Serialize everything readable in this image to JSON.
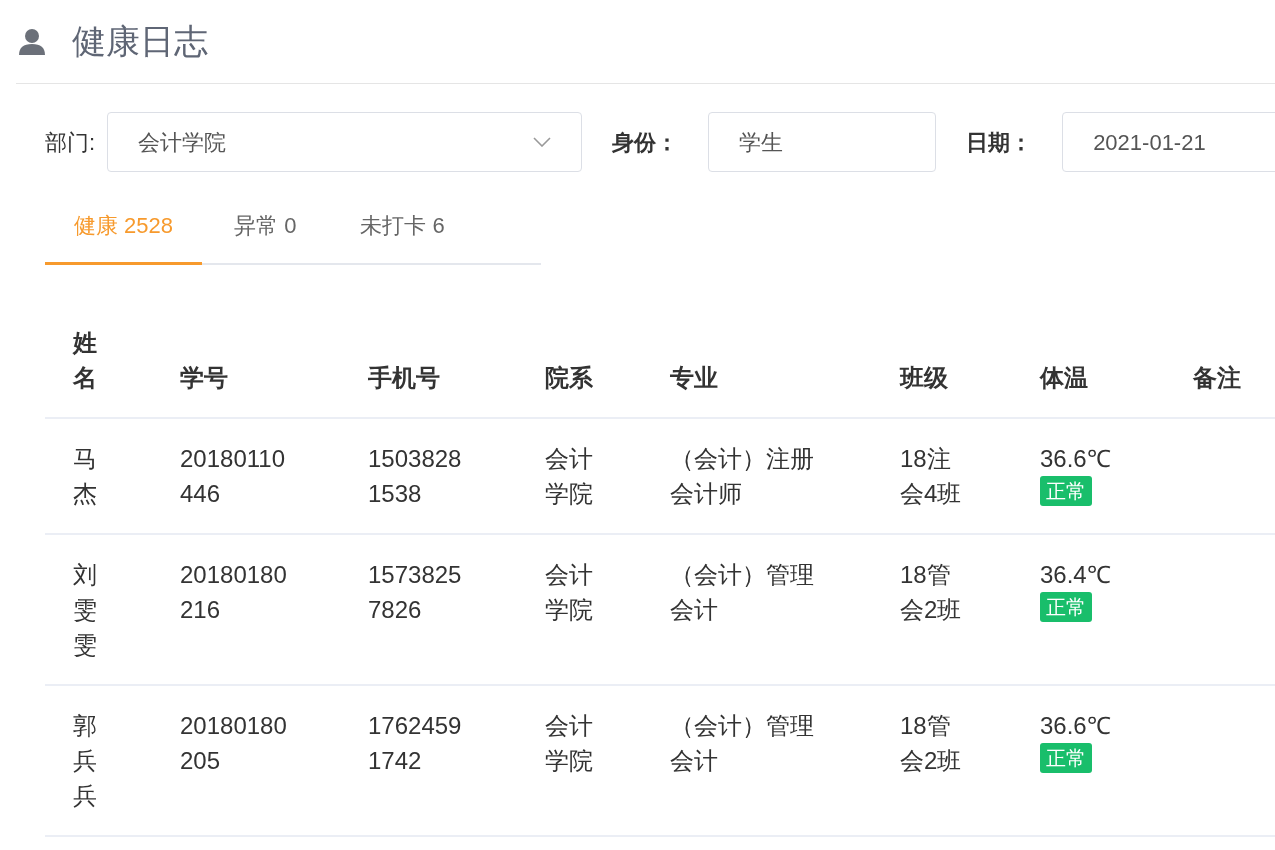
{
  "header": {
    "title": "健康日志"
  },
  "filters": [
    {
      "kind": "select",
      "label": "部门:",
      "value": "会计学院"
    },
    {
      "kind": "input",
      "label": "身份：",
      "value": "学生"
    },
    {
      "kind": "input",
      "label": "日期：",
      "value": "2021-01-21"
    }
  ],
  "tabs": [
    {
      "label": "健康 2528",
      "selected": true
    },
    {
      "label": "异常 0",
      "selected": false
    },
    {
      "label": "未打卡 6",
      "selected": false
    }
  ],
  "table": {
    "columns": [
      "姓名",
      "学号",
      "手机号",
      "院系",
      "专业",
      "班级",
      "体温",
      "备注"
    ],
    "rows": [
      {
        "name": "马杰",
        "id": "20180110446",
        "phone": "15038281538",
        "dept": "会计学院",
        "major": "（会计）注册会计师",
        "class": "18注会4班",
        "temp": "36.6℃",
        "status": "正常"
      },
      {
        "name": "刘雯雯",
        "id": "20180180216",
        "phone": "15738257826",
        "dept": "会计学院",
        "major": "（会计）管理会计",
        "class": "18管会2班",
        "temp": "36.4℃",
        "status": "正常"
      },
      {
        "name": "郭兵兵",
        "id": "20180180205",
        "phone": "17624591742",
        "dept": "会计学院",
        "major": "（会计）管理会计",
        "class": "18管会2班",
        "temp": "36.6℃",
        "status": "正常"
      }
    ]
  }
}
